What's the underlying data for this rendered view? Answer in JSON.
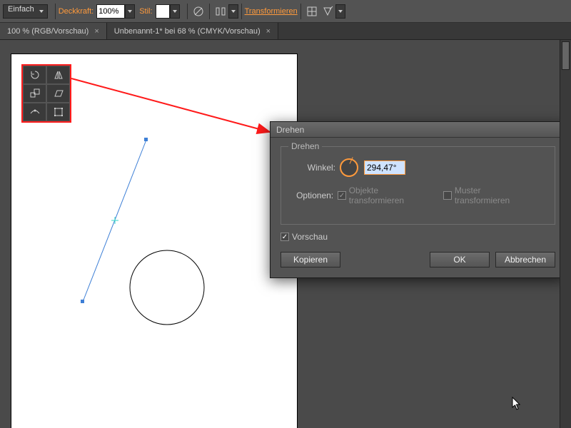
{
  "options_bar": {
    "stroke_style": "Einfach",
    "opacity_label": "Deckkraft:",
    "opacity_value": "100%",
    "style_label": "Stil:",
    "transform_link": "Transformieren"
  },
  "tabs": [
    {
      "label": "100 % (RGB/Vorschau)",
      "active": false
    },
    {
      "label": "Unbenannt-1* bei 68 % (CMYK/Vorschau)",
      "active": true
    }
  ],
  "dialog": {
    "title": "Drehen",
    "group_title": "Drehen",
    "angle_label": "Winkel:",
    "angle_value": "294,47°",
    "options_label": "Optionen:",
    "opt_transform_objects": "Objekte transformieren",
    "opt_transform_patterns": "Muster transformieren",
    "preview_label": "Vorschau",
    "btn_copy": "Kopieren",
    "btn_ok": "OK",
    "btn_cancel": "Abbrechen"
  },
  "palette_tools": [
    "rotate-tool",
    "reflect-tool",
    "scale-tool",
    "shear-tool",
    "reshape-tool",
    "free-transform-tool"
  ],
  "colors": {
    "accent": "#ff9a3c",
    "highlight_box": "#ff1a1a",
    "selection_blue": "#3d7fd6"
  }
}
